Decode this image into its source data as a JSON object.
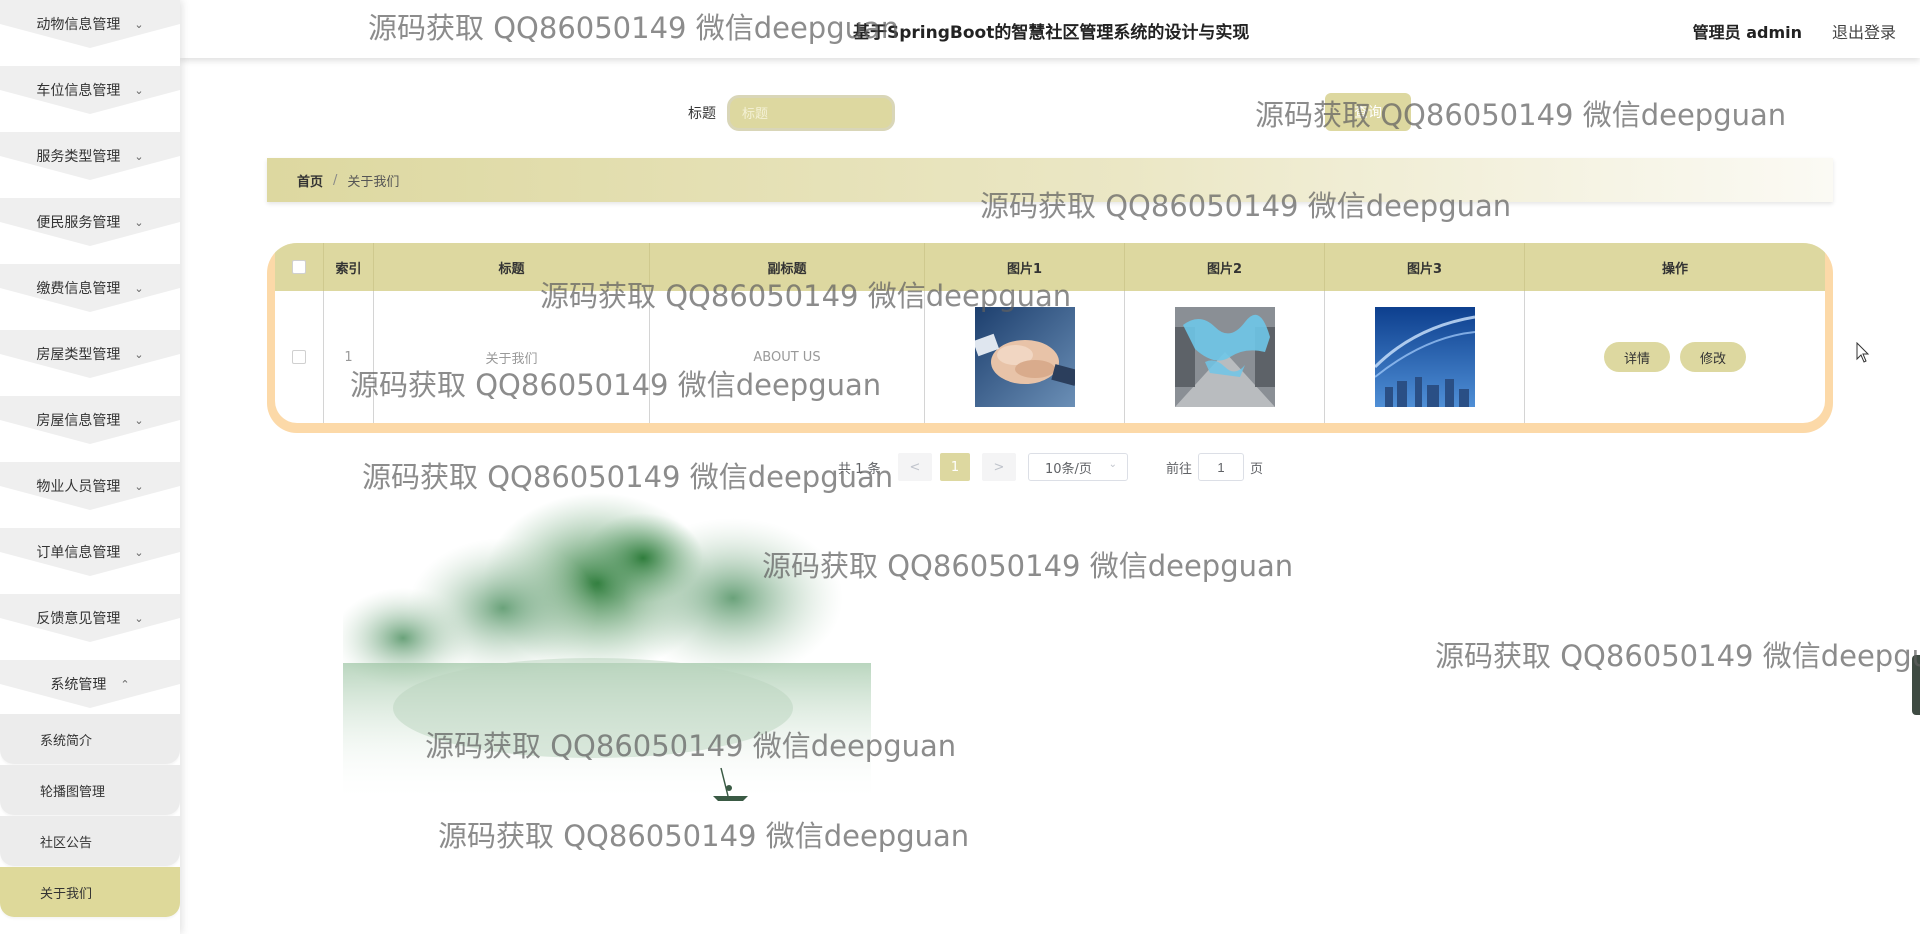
{
  "header": {
    "title": "基于SpringBoot的智慧社区管理系统的设计与实现",
    "user": "管理员 admin",
    "logout": "退出登录"
  },
  "sidebar": {
    "menus": [
      {
        "label": "动物信息管理",
        "expanded": false
      },
      {
        "label": "车位信息管理",
        "expanded": false
      },
      {
        "label": "服务类型管理",
        "expanded": false
      },
      {
        "label": "便民服务管理",
        "expanded": false
      },
      {
        "label": "缴费信息管理",
        "expanded": false
      },
      {
        "label": "房屋类型管理",
        "expanded": false
      },
      {
        "label": "房屋信息管理",
        "expanded": false
      },
      {
        "label": "物业人员管理",
        "expanded": false
      },
      {
        "label": "订单信息管理",
        "expanded": false
      },
      {
        "label": "反馈意见管理",
        "expanded": false
      },
      {
        "label": "系统管理",
        "expanded": true
      }
    ],
    "submenu": [
      {
        "label": "系统简介",
        "active": false
      },
      {
        "label": "轮播图管理",
        "active": false
      },
      {
        "label": "社区公告",
        "active": false
      },
      {
        "label": "关于我们",
        "active": true
      }
    ]
  },
  "search": {
    "label": "标题",
    "placeholder": "标题",
    "button": "查询"
  },
  "breadcrumb": {
    "home": "首页",
    "separator": "/",
    "current": "关于我们"
  },
  "table": {
    "headers": [
      "索引",
      "标题",
      "副标题",
      "图片1",
      "图片2",
      "图片3",
      "操作"
    ],
    "rows": [
      {
        "index": "1",
        "title": "关于我们",
        "subtitle": "ABOUT US",
        "image1": "hands-teamwork-photo",
        "image2": "warehouse-map-photo",
        "image3": "city-skyline-blue-photo",
        "actions": [
          "详情",
          "修改"
        ]
      }
    ]
  },
  "pagination": {
    "total": "共 1 条",
    "prev": "<",
    "current_page": "1",
    "next": ">",
    "page_size": "10条/页",
    "goto_label": "前往",
    "goto_value": "1",
    "goto_unit": "页"
  },
  "watermark": "源码获取 QQ86050149 微信deepguan",
  "colors": {
    "accent": "#ddd8a0",
    "table_border": "#fcd9a8",
    "sidebar_item": "#ececec"
  }
}
